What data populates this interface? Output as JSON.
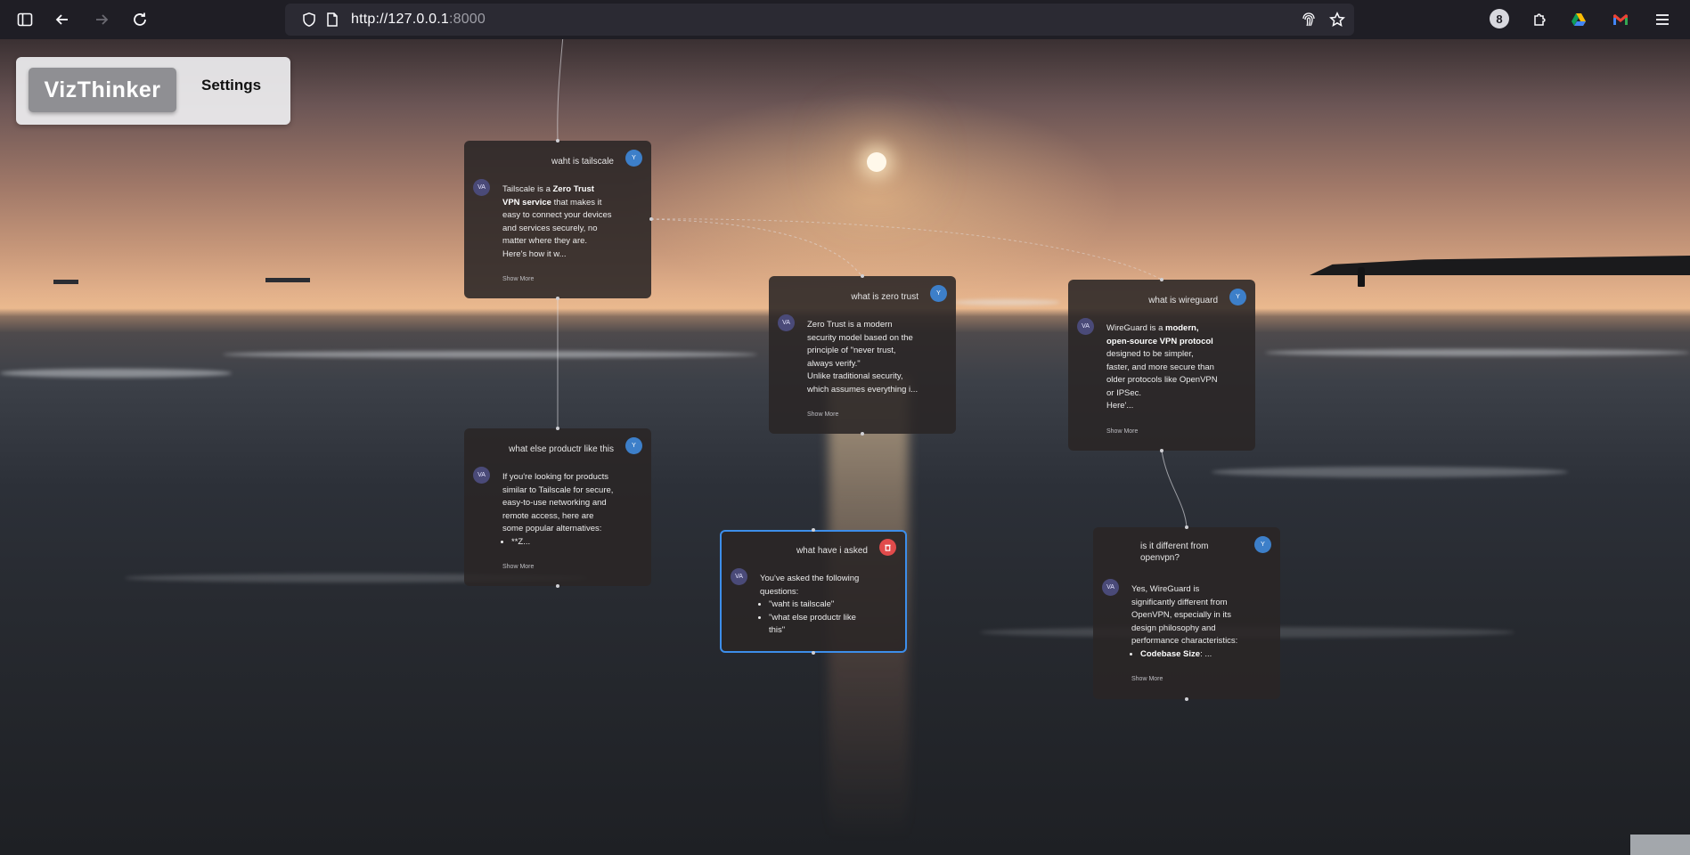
{
  "browser": {
    "url_host": "http://127.0.0.1",
    "url_port": ":8000",
    "extensions_badge": "8"
  },
  "app": {
    "logo": "VizThinker",
    "settings": "Settings"
  },
  "avatars": {
    "user": "Y",
    "assistant": "VA"
  },
  "colors": {
    "accent": "#3d8eea",
    "delete": "#e14b4b",
    "card_bg": "#2a2626"
  },
  "cards": [
    {
      "question": "waht is tailscale",
      "answer_parts": [
        {
          "t": "Tailscale is a "
        },
        {
          "b": "Zero Trust VPN service"
        },
        {
          "t": " that makes it easy to connect your devices and services securely, no matter where they are."
        },
        {
          "br": true
        },
        {
          "t": "Here's how it w..."
        }
      ],
      "show_more": "Show More"
    },
    {
      "question": "what is zero trust",
      "answer_parts": [
        {
          "t": "Zero Trust is a modern security model based on the principle of \"never trust, always verify.\""
        },
        {
          "br": true
        },
        {
          "t": "Unlike traditional security, which assumes everything i..."
        }
      ],
      "show_more": "Show More"
    },
    {
      "question": "what is wireguard",
      "answer_parts": [
        {
          "t": "WireGuard is a "
        },
        {
          "b": "modern, open-source VPN protocol"
        },
        {
          "t": " designed to be simpler, faster, and more secure than older protocols like OpenVPN or IPSec."
        },
        {
          "br": true
        },
        {
          "t": "Here'..."
        }
      ],
      "show_more": "Show More"
    },
    {
      "question": "what else productr like this",
      "answer_parts": [
        {
          "t": "If you're looking for products similar to Tailscale for secure, easy-to-use networking and remote access, here are some popular alternatives:"
        },
        {
          "li": "**Z..."
        }
      ],
      "show_more": "Show More"
    },
    {
      "question": "what have i asked",
      "answer_parts": [
        {
          "t": "You've asked the following questions:"
        },
        {
          "li": "\"waht is tailscale\""
        },
        {
          "li": "\"what else productr like this\""
        }
      ],
      "show_more": ""
    },
    {
      "question": "is it different from openvpn?",
      "answer_parts": [
        {
          "t": "Yes, WireGuard is significantly different from OpenVPN, especially in its design philosophy and performance characteristics:"
        },
        {
          "lib": "Codebase Size",
          "rest": ": ..."
        }
      ],
      "show_more": "Show More"
    }
  ]
}
